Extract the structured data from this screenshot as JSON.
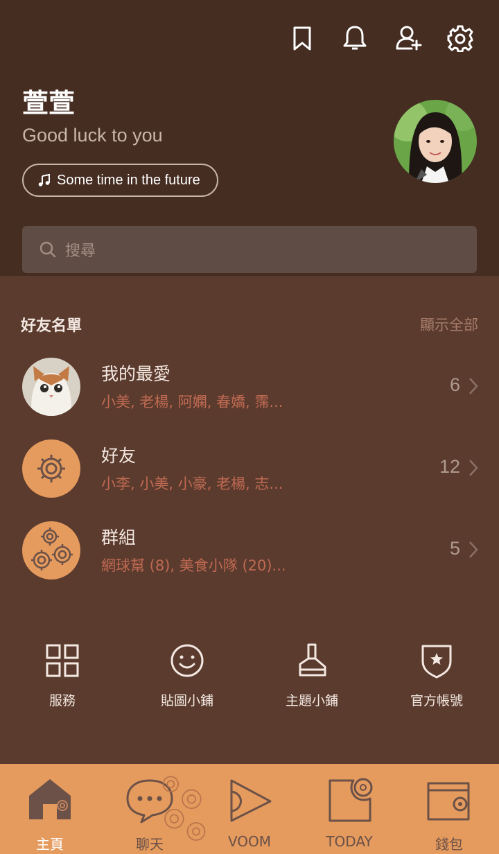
{
  "header": {
    "profile_name": "萱萱",
    "status_message": "Good luck to you",
    "music": "Some time in the future",
    "search_placeholder": "搜尋"
  },
  "friends": {
    "section_title": "好友名單",
    "show_all": "顯示全部",
    "rows": [
      {
        "title": "我的最愛",
        "members": "小美, 老楊, 阿嫻, 春嬌, 霈...",
        "count": "6"
      },
      {
        "title": "好友",
        "members": "小李, 小美, 小豪, 老楊, 志...",
        "count": "12"
      },
      {
        "title": "群組",
        "members": "網球幫 (8), 美食小隊 (20)...",
        "count": "5"
      }
    ]
  },
  "shortcuts": [
    {
      "label": "服務",
      "icon": "grid-icon"
    },
    {
      "label": "貼圖小鋪",
      "icon": "smiley-icon"
    },
    {
      "label": "主題小鋪",
      "icon": "brush-icon"
    },
    {
      "label": "官方帳號",
      "icon": "shield-star-icon"
    }
  ],
  "tabs": [
    {
      "label": "主頁",
      "icon": "home-icon",
      "active": true
    },
    {
      "label": "聊天",
      "icon": "chat-icon"
    },
    {
      "label": "VOOM",
      "icon": "play-icon"
    },
    {
      "label": "TODAY",
      "icon": "today-icon"
    },
    {
      "label": "錢包",
      "icon": "wallet-icon"
    }
  ],
  "colors": {
    "header_bg": "#452d22",
    "body_bg": "#5b3b2e",
    "accent_orange": "#e59a5e",
    "member_text": "#c06a52"
  }
}
